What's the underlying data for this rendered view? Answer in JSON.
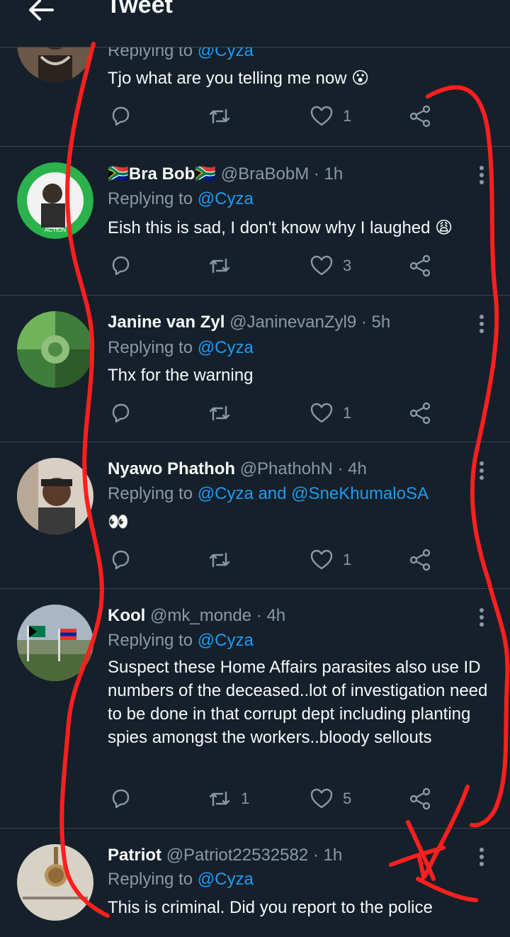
{
  "header": {
    "title": "Tweet",
    "back_icon": "arrow-left-icon"
  },
  "colors": {
    "background": "#15202b",
    "accent": "#1d9bf0",
    "muted": "#8b98a5",
    "annotation": "#ff1f1f"
  },
  "tweets": [
    {
      "name": "",
      "handle": "",
      "dot": "",
      "time": "",
      "replying_prefix": "Replying to ",
      "mentions": "@Cyza",
      "text": "Tjo what are you telling me now 😮",
      "counts": {
        "reply": "",
        "retweet": "",
        "like": "1"
      }
    },
    {
      "name": "🇿🇦Bra Bob🇿🇦",
      "handle": "@BraBobM",
      "dot": "·",
      "time": "1h",
      "replying_prefix": "Replying to ",
      "mentions": "@Cyza",
      "text": "Eish this is sad, I don't know why I laughed 😩",
      "counts": {
        "reply": "",
        "retweet": "",
        "like": "3"
      }
    },
    {
      "name": "Janine van Zyl",
      "handle": "@JaninevanZyl9",
      "dot": "·",
      "time": "5h",
      "replying_prefix": "Replying to ",
      "mentions": "@Cyza",
      "text": "Thx for the warning",
      "counts": {
        "reply": "",
        "retweet": "",
        "like": "1"
      }
    },
    {
      "name": "Nyawo Phathoh",
      "handle": "@PhathohN",
      "dot": "·",
      "time": "4h",
      "replying_prefix": "Replying to ",
      "mentions": "@Cyza and @SneKhumaloSA",
      "text": "👀",
      "counts": {
        "reply": "",
        "retweet": "",
        "like": "1"
      }
    },
    {
      "name": "Kool",
      "handle": "@mk_monde",
      "dot": "·",
      "time": "4h",
      "replying_prefix": "Replying to ",
      "mentions": "@Cyza",
      "text": "Suspect these Home Affairs parasites also use ID numbers of the deceased..lot of investigation need to be done in that corrupt dept including planting spies amongst the workers..bloody sellouts",
      "counts": {
        "reply": "",
        "retweet": "1",
        "like": "5"
      }
    },
    {
      "name": "Patriot",
      "handle": "@Patriot22532582",
      "dot": "·",
      "time": "1h",
      "replying_prefix": "Replying to ",
      "mentions": "@Cyza",
      "text": "This is criminal. Did you report to the police",
      "counts": {
        "reply": "",
        "retweet": "",
        "like": ""
      }
    }
  ],
  "icons": {
    "reply": "reply-icon",
    "retweet": "retweet-icon",
    "like": "heart-icon",
    "share": "share-icon",
    "more": "more-options-icon"
  }
}
